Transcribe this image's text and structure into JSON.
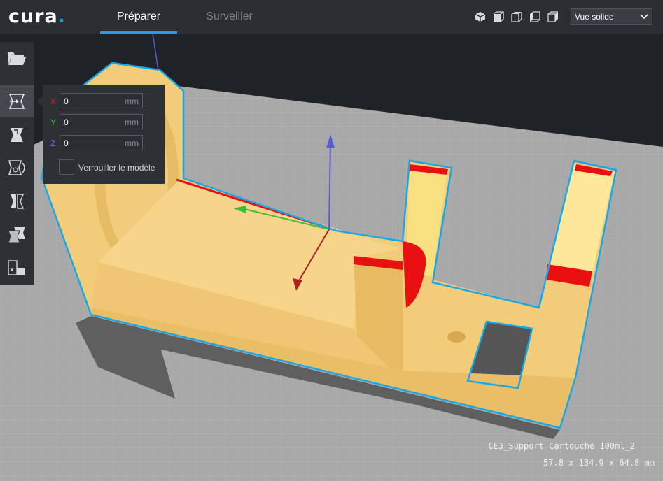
{
  "app": {
    "logo": "cura",
    "logo_dot": "."
  },
  "tabs": [
    {
      "label": "Préparer",
      "active": true
    },
    {
      "label": "Surveiller",
      "active": false
    }
  ],
  "camera_icons": [
    "3d-view-icon",
    "front-view-icon",
    "top-view-icon",
    "left-view-icon",
    "right-view-icon"
  ],
  "view_select": {
    "value": "Vue solide"
  },
  "toolbar": {
    "items": [
      "open-folder-icon",
      "move-tool-icon",
      "scale-tool-icon",
      "rotate-tool-icon",
      "mirror-tool-icon",
      "per-model-settings-icon",
      "support-blocker-icon"
    ],
    "active": "move-tool-icon"
  },
  "move_panel": {
    "x": {
      "label": "X",
      "value": "0",
      "unit": "mm"
    },
    "y": {
      "label": "Y",
      "value": "0",
      "unit": "mm"
    },
    "z": {
      "label": "Z",
      "value": "0",
      "unit": "mm"
    },
    "lock_label": "Verrouiller le modèle"
  },
  "object": {
    "name": "CE3_Support Cartouche 100ml_2",
    "dimensions": "57.8 x 134.9 x 64.8 mm"
  },
  "colors": {
    "accent": "#1da1e2",
    "topbar": "#2a2d32",
    "model": "#f3cc7a",
    "overhang": "#ff0000",
    "build_plate": "#a9a9a9",
    "axis_x": "#e02020",
    "axis_y": "#3bbf3b",
    "axis_z": "#5b5bd8"
  }
}
